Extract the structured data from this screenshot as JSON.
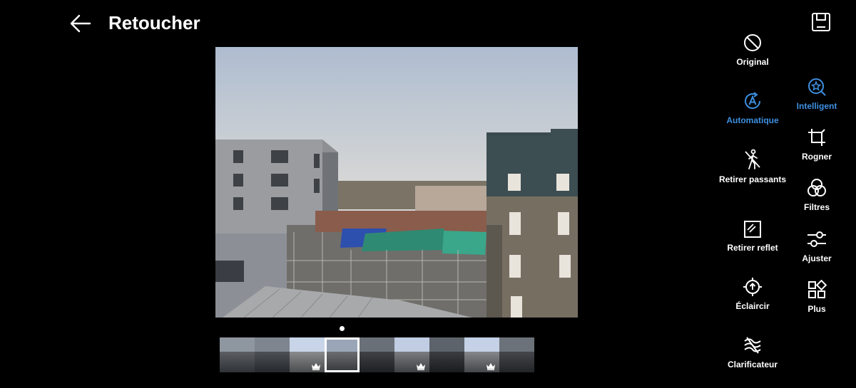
{
  "header": {
    "title": "Retoucher",
    "back_icon": "back-arrow-icon",
    "save_icon": "save-icon"
  },
  "left_tools": [
    {
      "label": "Original",
      "icon": "original-icon",
      "active": false
    },
    {
      "label": "Automatique",
      "icon": "auto-icon",
      "active": true
    },
    {
      "label": "Retirer passants",
      "icon": "remove-passersby-icon",
      "active": false
    },
    {
      "label": "Retirer reflet",
      "icon": "remove-reflection-icon",
      "active": false
    },
    {
      "label": "Éclaircir",
      "icon": "brighten-icon",
      "active": false
    },
    {
      "label": "Clarificateur",
      "icon": "clarifier-icon",
      "active": false
    }
  ],
  "right_tools": [
    {
      "label": "Intelligent",
      "icon": "smart-icon",
      "active": true
    },
    {
      "label": "Rogner",
      "icon": "crop-icon",
      "active": false
    },
    {
      "label": "Filtres",
      "icon": "filters-icon",
      "active": false
    },
    {
      "label": "Ajuster",
      "icon": "adjust-icon",
      "active": false
    },
    {
      "label": "Plus",
      "icon": "more-icon",
      "active": false
    }
  ],
  "colors": {
    "accent": "#3d8fe0",
    "background": "#000000",
    "text": "#ffffff"
  },
  "thumbnails": {
    "count": 9,
    "selected_index": 3,
    "premium_indices": [
      2,
      5,
      7
    ]
  }
}
